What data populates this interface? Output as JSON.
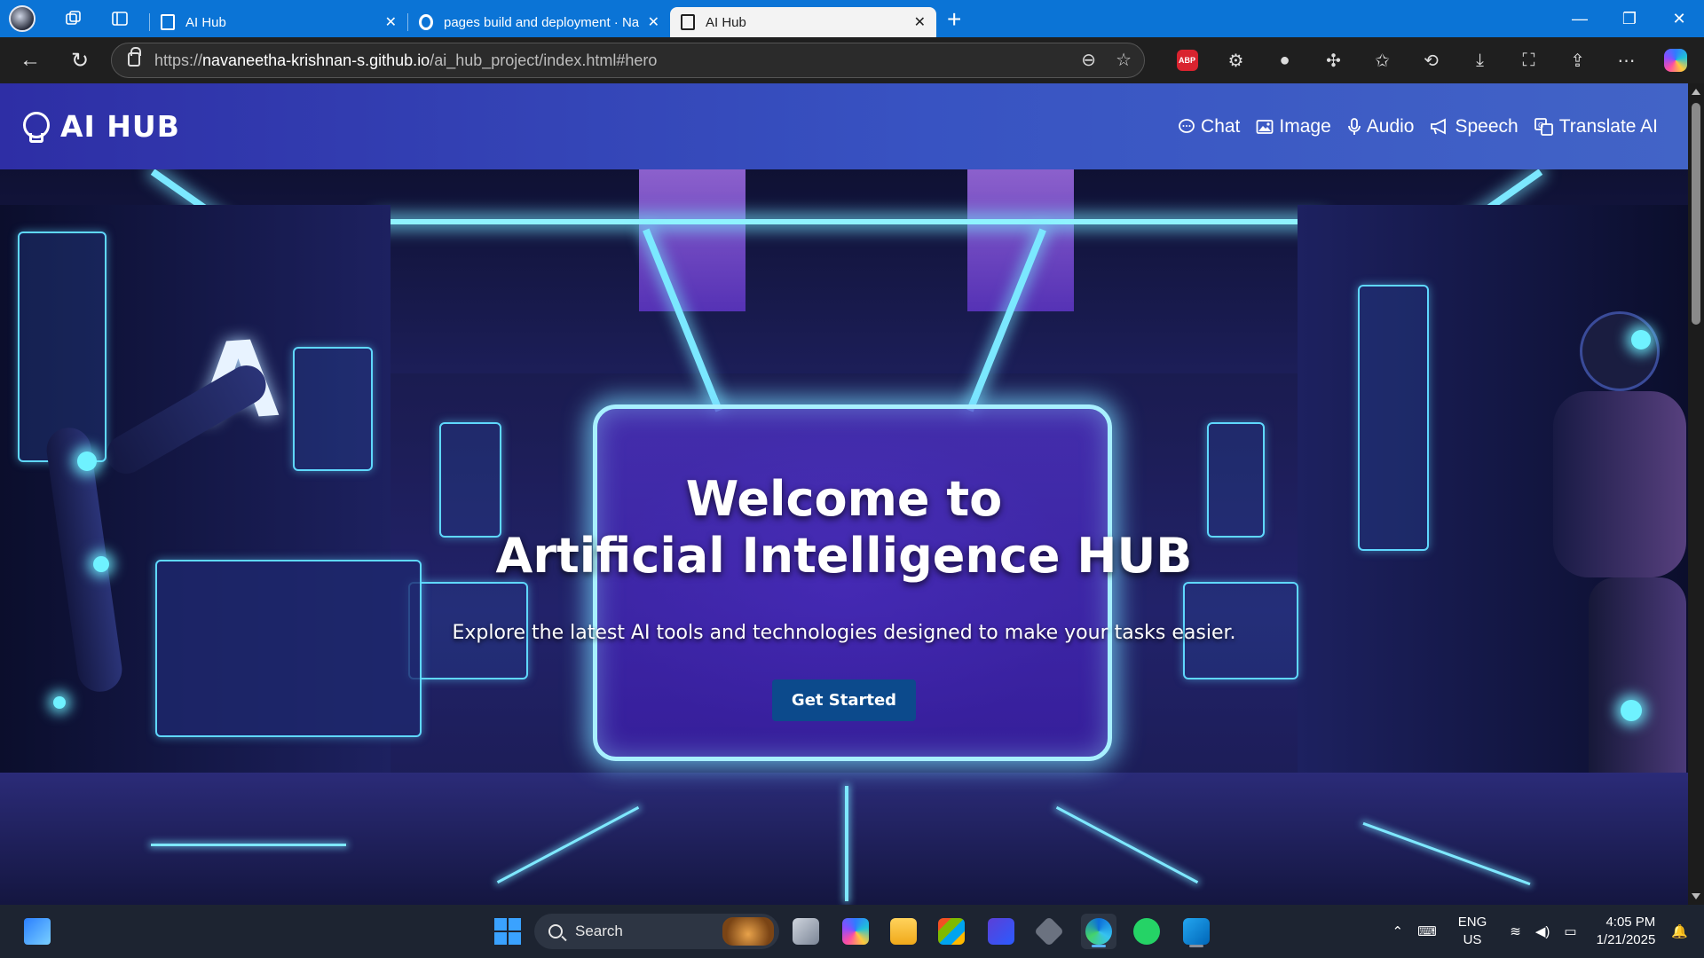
{
  "browser": {
    "tabs": [
      {
        "title": "AI Hub",
        "active": false
      },
      {
        "title": "pages build and deployment · Na",
        "active": false
      },
      {
        "title": "AI Hub",
        "active": true
      }
    ],
    "new_tab_label": "+",
    "url_prefix": "https://",
    "url_host": "navaneetha-krishnan-s.github.io",
    "url_path": "/ai_hub_project/index.html#hero",
    "extensions": [
      "adblock-icon",
      "extension-puzzle-icon",
      "cookie-icon"
    ],
    "abp_label": "ABP"
  },
  "site": {
    "brand": "AI HUB",
    "nav": [
      {
        "label": "Chat",
        "icon": "chat-icon"
      },
      {
        "label": "Image",
        "icon": "image-icon"
      },
      {
        "label": "Audio",
        "icon": "microphone-icon"
      },
      {
        "label": "Speech",
        "icon": "megaphone-icon"
      },
      {
        "label": "Translate AI",
        "icon": "translate-icon"
      }
    ],
    "hero": {
      "title_line1": "Welcome to",
      "title_line2": "Artificial Intelligence HUB",
      "subtitle": "Explore the latest AI tools and technologies designed to make your tasks easier.",
      "button": "Get Started"
    },
    "colors": {
      "header_start": "#2e2ea5",
      "header_end": "#4264c7",
      "button": "#0c4a8c",
      "neon": "#7be8ff"
    }
  },
  "taskbar": {
    "search_label": "Search",
    "language_line1": "ENG",
    "language_line2": "US",
    "time": "4:05 PM",
    "date": "1/21/2025"
  }
}
